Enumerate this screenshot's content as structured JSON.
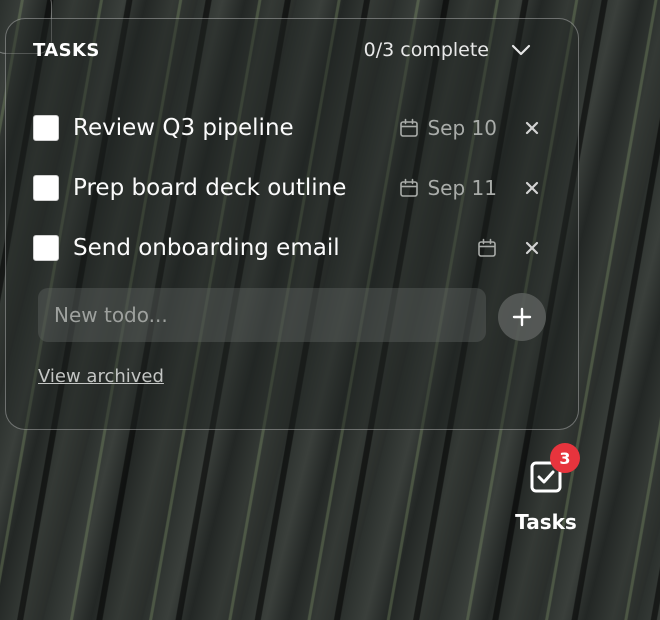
{
  "panel": {
    "title": "TASKS",
    "progress_text": "0/3 complete",
    "collapse_icon": "chevron-down-icon"
  },
  "tasks": [
    {
      "title": "Review Q3 pipeline",
      "due": "Sep 10",
      "completed": false
    },
    {
      "title": "Prep board deck outline",
      "due": "Sep 11",
      "completed": false
    },
    {
      "title": "Send onboarding email",
      "due": "",
      "completed": false
    }
  ],
  "new_todo": {
    "placeholder": "New todo...",
    "value": "",
    "add_icon": "plus-icon"
  },
  "archived_link": "View archived",
  "dock": {
    "label": "Tasks",
    "badge_count": "3",
    "icon": "checkbox-check-icon"
  },
  "colors": {
    "badge": "#e7343d",
    "panel_border": "#ffffff"
  }
}
